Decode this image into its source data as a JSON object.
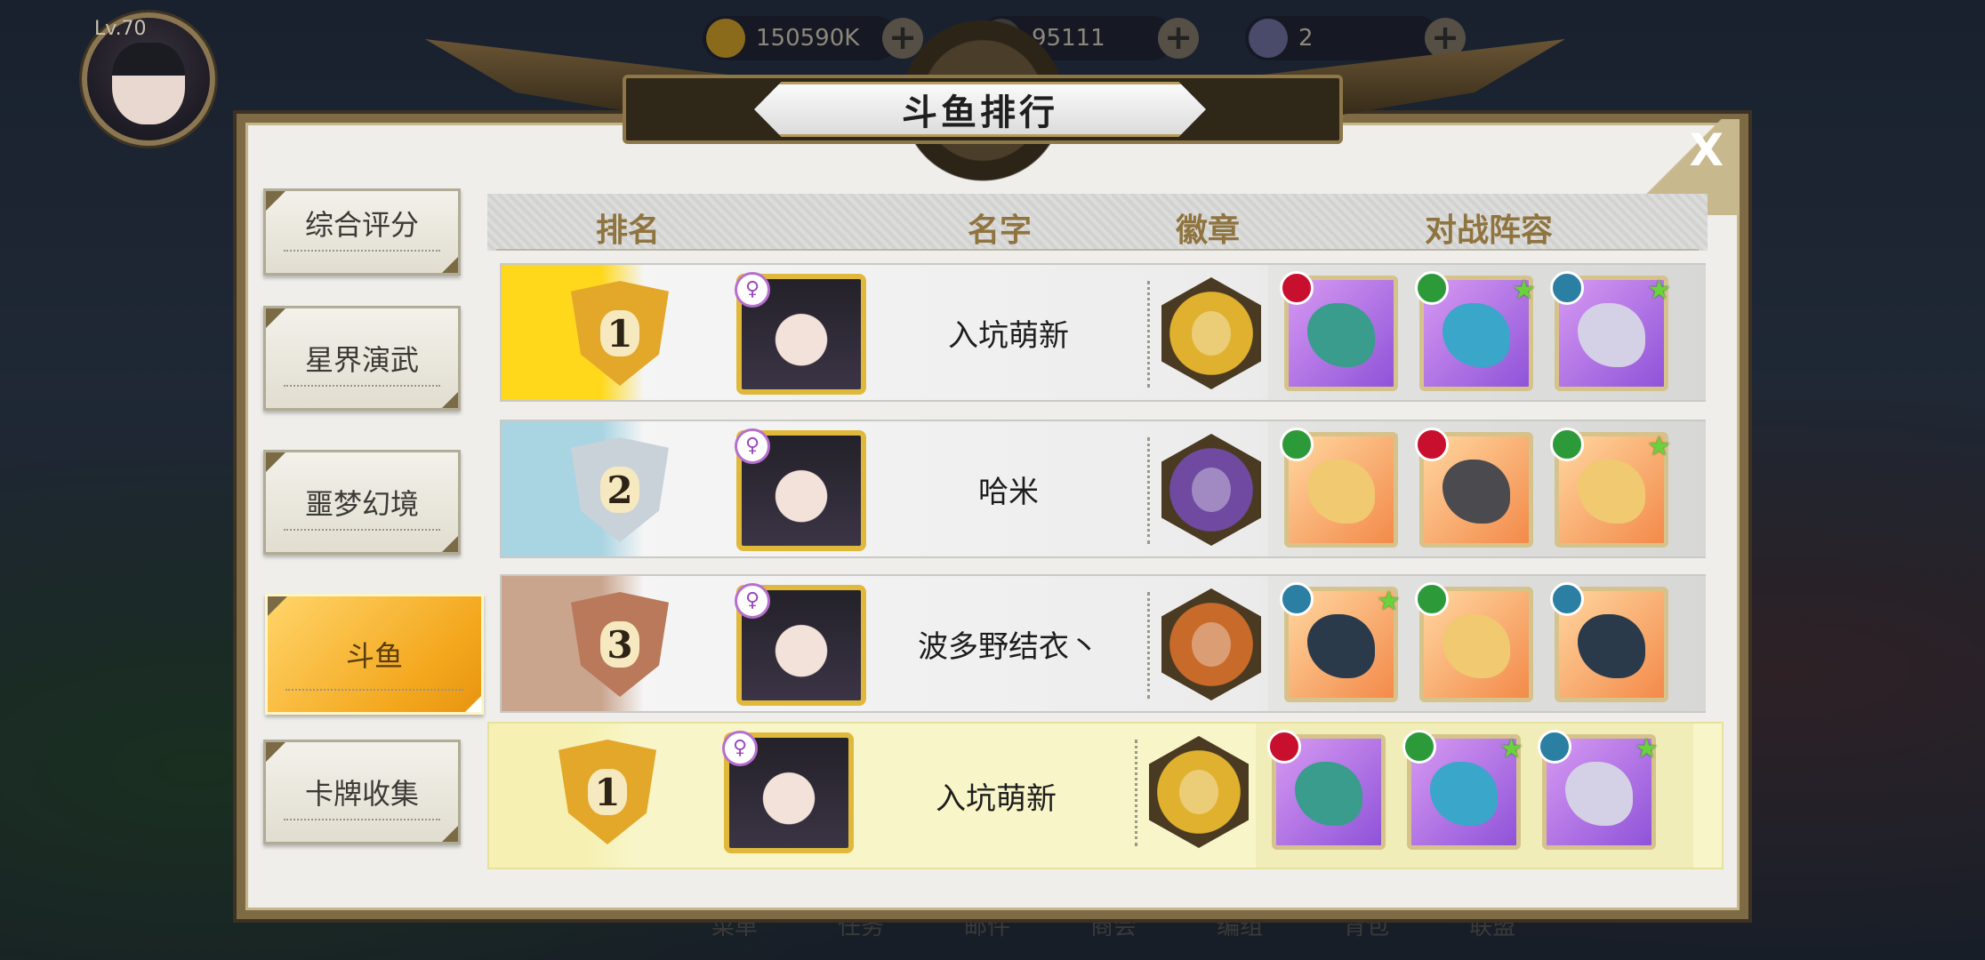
{
  "hud": {
    "level": "Lv.70",
    "gold": "150590K",
    "gems": "95111",
    "other": "2"
  },
  "bottom_nav": [
    "菜单",
    "任务",
    "邮件",
    "商会",
    "编组",
    "背包",
    "联盟"
  ],
  "panel": {
    "title": "斗鱼排行",
    "close_label": "X"
  },
  "tabs": [
    {
      "label": "综合评分",
      "active": false
    },
    {
      "label": "星界演武",
      "active": false
    },
    {
      "label": "噩梦幻境",
      "active": false
    },
    {
      "label": "斗鱼",
      "active": true
    },
    {
      "label": "卡牌收集",
      "active": false
    }
  ],
  "table": {
    "headers": {
      "rank": "排名",
      "name": "名字",
      "badge": "徽章",
      "team": "对战阵容"
    },
    "rows": [
      {
        "rank": "1",
        "name": "入坑萌新",
        "rank_color": "#ffd81c",
        "shield": "#e3a72a",
        "badge_color": "#e0b12e",
        "team": [
          {
            "bg": "purple",
            "tag": "#c8102e",
            "creature": "#3a9c8c",
            "star": false
          },
          {
            "bg": "purple",
            "tag": "#2d9a3a",
            "creature": "#3aa6c9",
            "star": true
          },
          {
            "bg": "purple",
            "tag": "#2a7fa3",
            "creature": "#d4d0e5",
            "star": true
          }
        ]
      },
      {
        "rank": "2",
        "name": "哈米",
        "rank_color": "#a9d4e2",
        "shield": "#c9d2d8",
        "badge_color": "#6f4aa0",
        "team": [
          {
            "bg": "orange",
            "tag": "#2d9a3a",
            "creature": "#f0c970",
            "star": false
          },
          {
            "bg": "orange",
            "tag": "#c8102e",
            "creature": "#4b4a4f",
            "star": false
          },
          {
            "bg": "orange",
            "tag": "#2d9a3a",
            "creature": "#f0c970",
            "star": true
          }
        ]
      },
      {
        "rank": "3",
        "name": "波多野结衣丶",
        "rank_color": "#caa58e",
        "shield": "#b9795a",
        "badge_color": "#c86a2a",
        "team": [
          {
            "bg": "orange",
            "tag": "#2a7fa3",
            "creature": "#2a3a4a",
            "star": true
          },
          {
            "bg": "orange",
            "tag": "#2d9a3a",
            "creature": "#f0c970",
            "star": false
          },
          {
            "bg": "orange",
            "tag": "#2a7fa3",
            "creature": "#2a3a4a",
            "star": false
          }
        ]
      }
    ],
    "mine": {
      "rank": "1",
      "name": "入坑萌新",
      "rank_color": "#f6f1b3",
      "shield": "#e3a72a",
      "badge_color": "#e0b12e",
      "team": [
        {
          "bg": "purple",
          "tag": "#c8102e",
          "creature": "#3a9c8c",
          "star": false
        },
        {
          "bg": "purple",
          "tag": "#2d9a3a",
          "creature": "#3aa6c9",
          "star": true
        },
        {
          "bg": "purple",
          "tag": "#2a7fa3",
          "creature": "#d4d0e5",
          "star": true
        }
      ]
    }
  }
}
